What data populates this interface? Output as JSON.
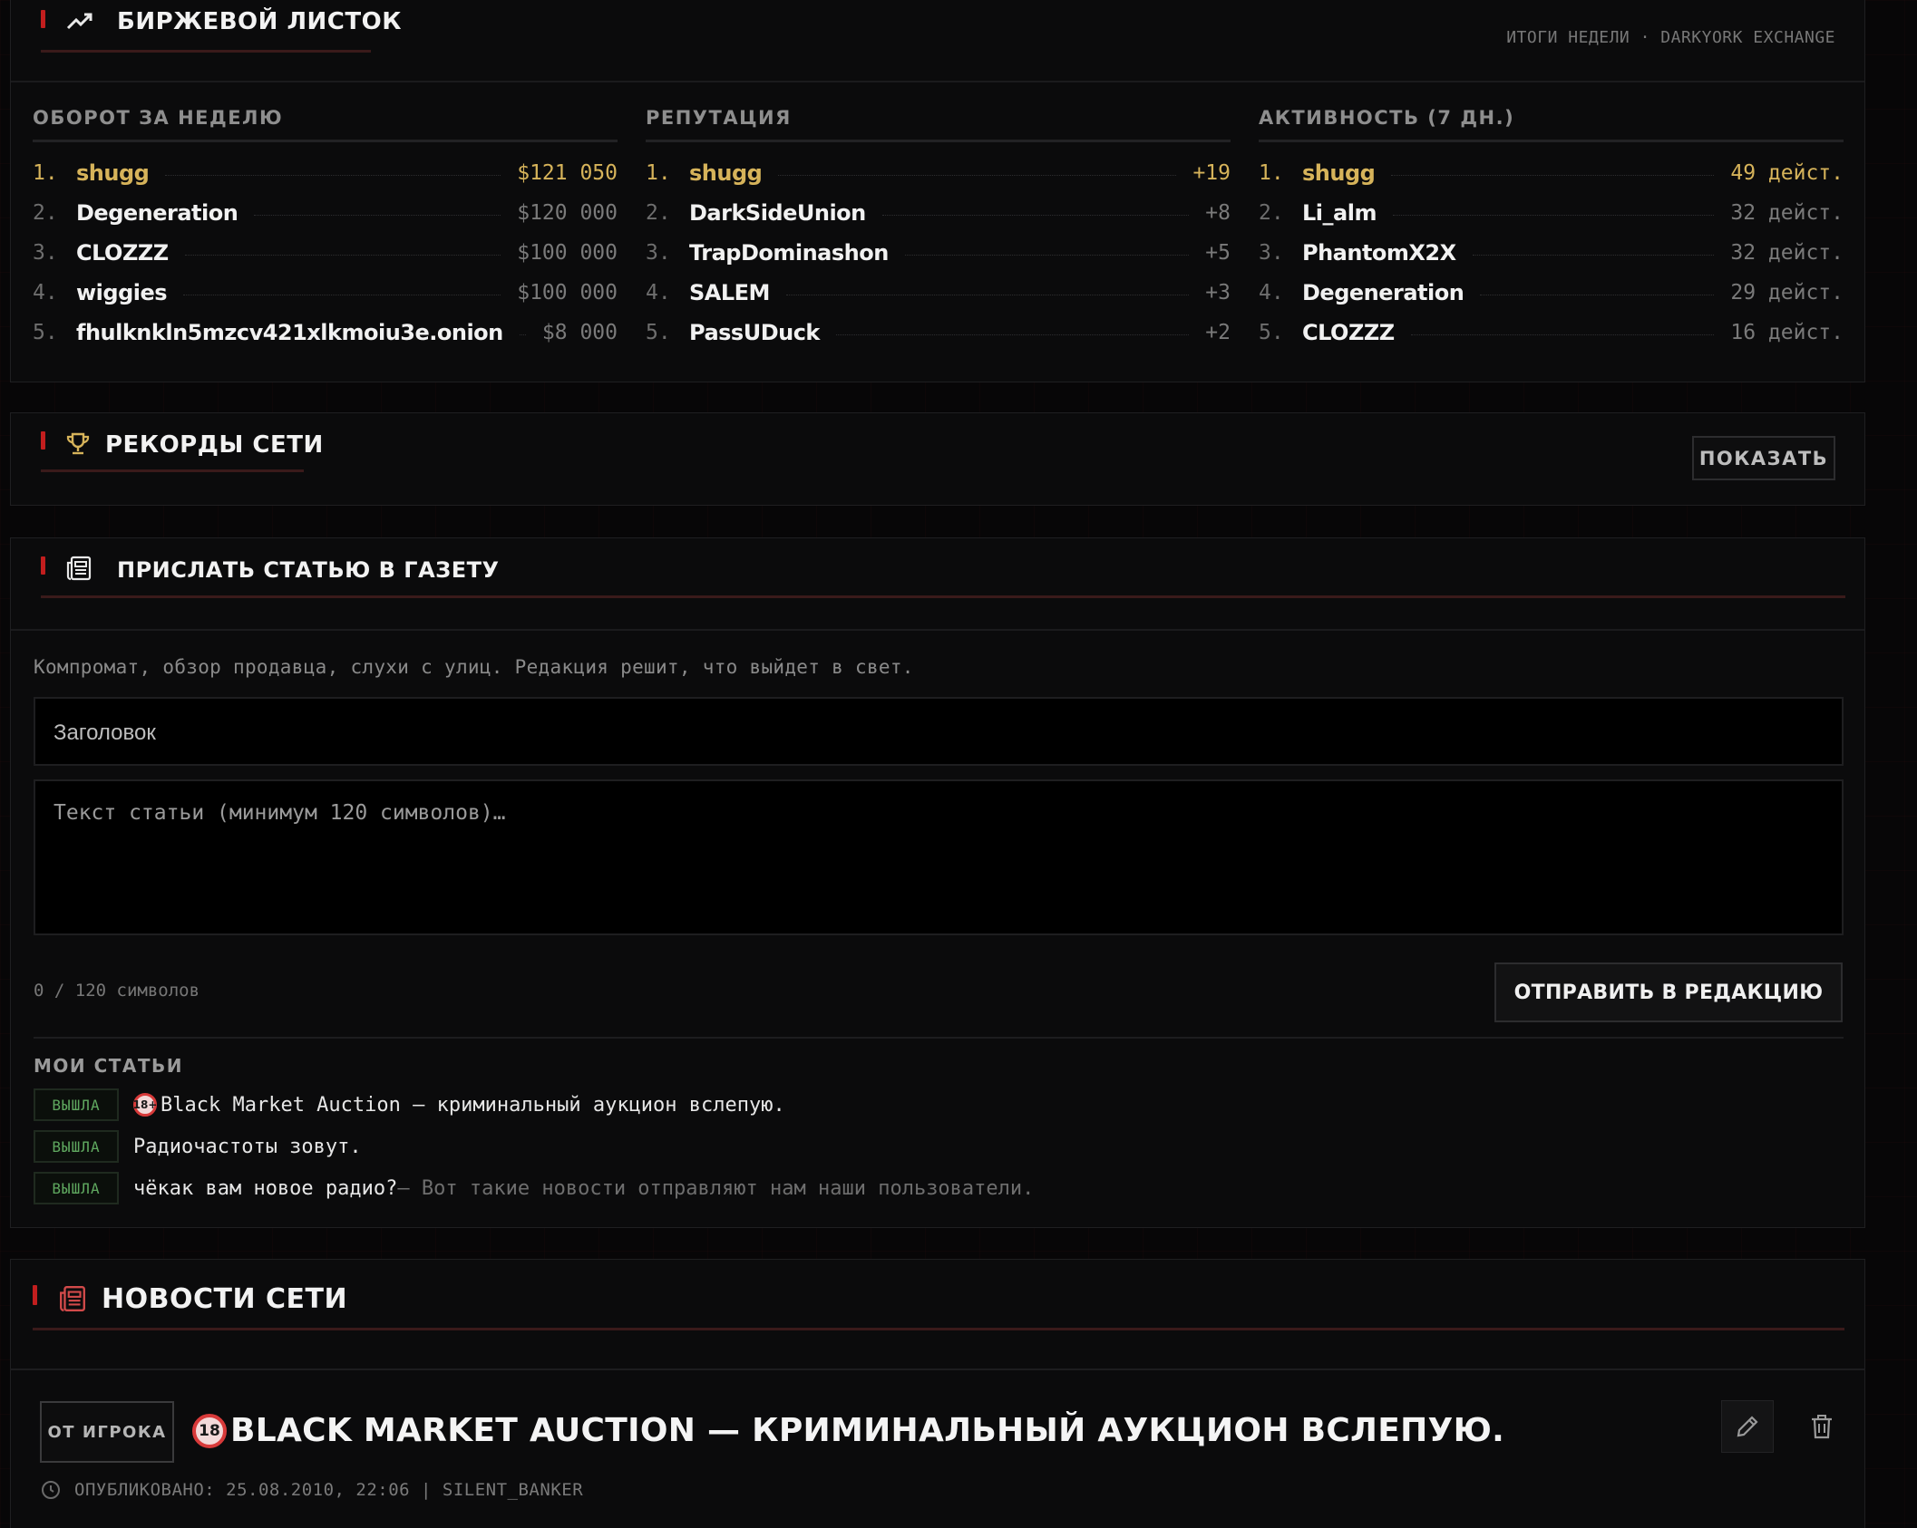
{
  "exchange": {
    "title": "БИРЖЕВОЙ ЛИСТОК",
    "subtitle": "ИТОГИ НЕДЕЛИ · DARKYORK EXCHANGE",
    "columns": [
      {
        "title": "ОБОРОТ ЗА НЕДЕЛЮ",
        "rows": [
          {
            "rank": "1.",
            "name": "shugg",
            "value": "$121 050"
          },
          {
            "rank": "2.",
            "name": "Degeneration",
            "value": "$120 000"
          },
          {
            "rank": "3.",
            "name": "CLOZZZ",
            "value": "$100 000"
          },
          {
            "rank": "4.",
            "name": "wiggies",
            "value": "$100 000"
          },
          {
            "rank": "5.",
            "name": "fhulknkln5mzcv421xlkmoiu3e.onion",
            "value": "$8 000"
          }
        ]
      },
      {
        "title": "РЕПУТАЦИЯ",
        "rows": [
          {
            "rank": "1.",
            "name": "shugg",
            "value": "+19"
          },
          {
            "rank": "2.",
            "name": "DarkSideUnion",
            "value": "+8"
          },
          {
            "rank": "3.",
            "name": "TrapDominashon",
            "value": "+5"
          },
          {
            "rank": "4.",
            "name": "SALEM",
            "value": "+3"
          },
          {
            "rank": "5.",
            "name": "PassUDuck",
            "value": "+2"
          }
        ]
      },
      {
        "title": "АКТИВНОСТЬ (7 ДН.)",
        "rows": [
          {
            "rank": "1.",
            "name": "shugg",
            "value": "49 дейст."
          },
          {
            "rank": "2.",
            "name": "Li_alm",
            "value": "32 дейст."
          },
          {
            "rank": "3.",
            "name": "PhantomX2X",
            "value": "32 дейст."
          },
          {
            "rank": "4.",
            "name": "Degeneration",
            "value": "29 дейст."
          },
          {
            "rank": "5.",
            "name": "CLOZZZ",
            "value": "16 дейст."
          }
        ]
      }
    ]
  },
  "records": {
    "title": "РЕКОРДЫ СЕТИ",
    "show_label": "ПОКАЗАТЬ"
  },
  "submit": {
    "title": "ПРИСЛАТЬ СТАТЬЮ В ГАЗЕТУ",
    "description": "Компромат, обзор продавца, слухи с улиц. Редакция решит, что выйдет в свет.",
    "title_placeholder": "Заголовок",
    "body_placeholder": "Текст статьи (минимум 120 символов)…",
    "counter": "0 / 120 символов",
    "send_label": "ОТПРАВИТЬ В РЕДАКЦИЮ",
    "my_articles_title": "МОИ СТАТЬИ",
    "articles": [
      {
        "status": "ВЫШЛА",
        "icon": "18+",
        "title": "Black Market Auction — криминальный аукцион вслепую.",
        "note": ""
      },
      {
        "status": "ВЫШЛА",
        "icon": "",
        "title": "Радиочастоты зовут.",
        "note": ""
      },
      {
        "status": "ВЫШЛА",
        "icon": "",
        "title": "чёкак вам новое радио?",
        "note": " — Вот такие новости отправляют нам наши пользователи."
      }
    ]
  },
  "news": {
    "title": "НОВОСТИ СЕТИ",
    "item": {
      "tag": "ОТ ИГРОКА",
      "icon": "18",
      "headline": "BLACK MARKET AUCTION — КРИМИНАЛЬНЫЙ АУКЦИОН ВСЛЕПУЮ.",
      "meta": "ОПУБЛИКОВАНО: 25.08.2010, 22:06 | SILENT_BANKER"
    }
  },
  "colors": {
    "accent_red": "#c21e1e",
    "gold": "#d6b35a",
    "status_green": "#5fa85f"
  }
}
